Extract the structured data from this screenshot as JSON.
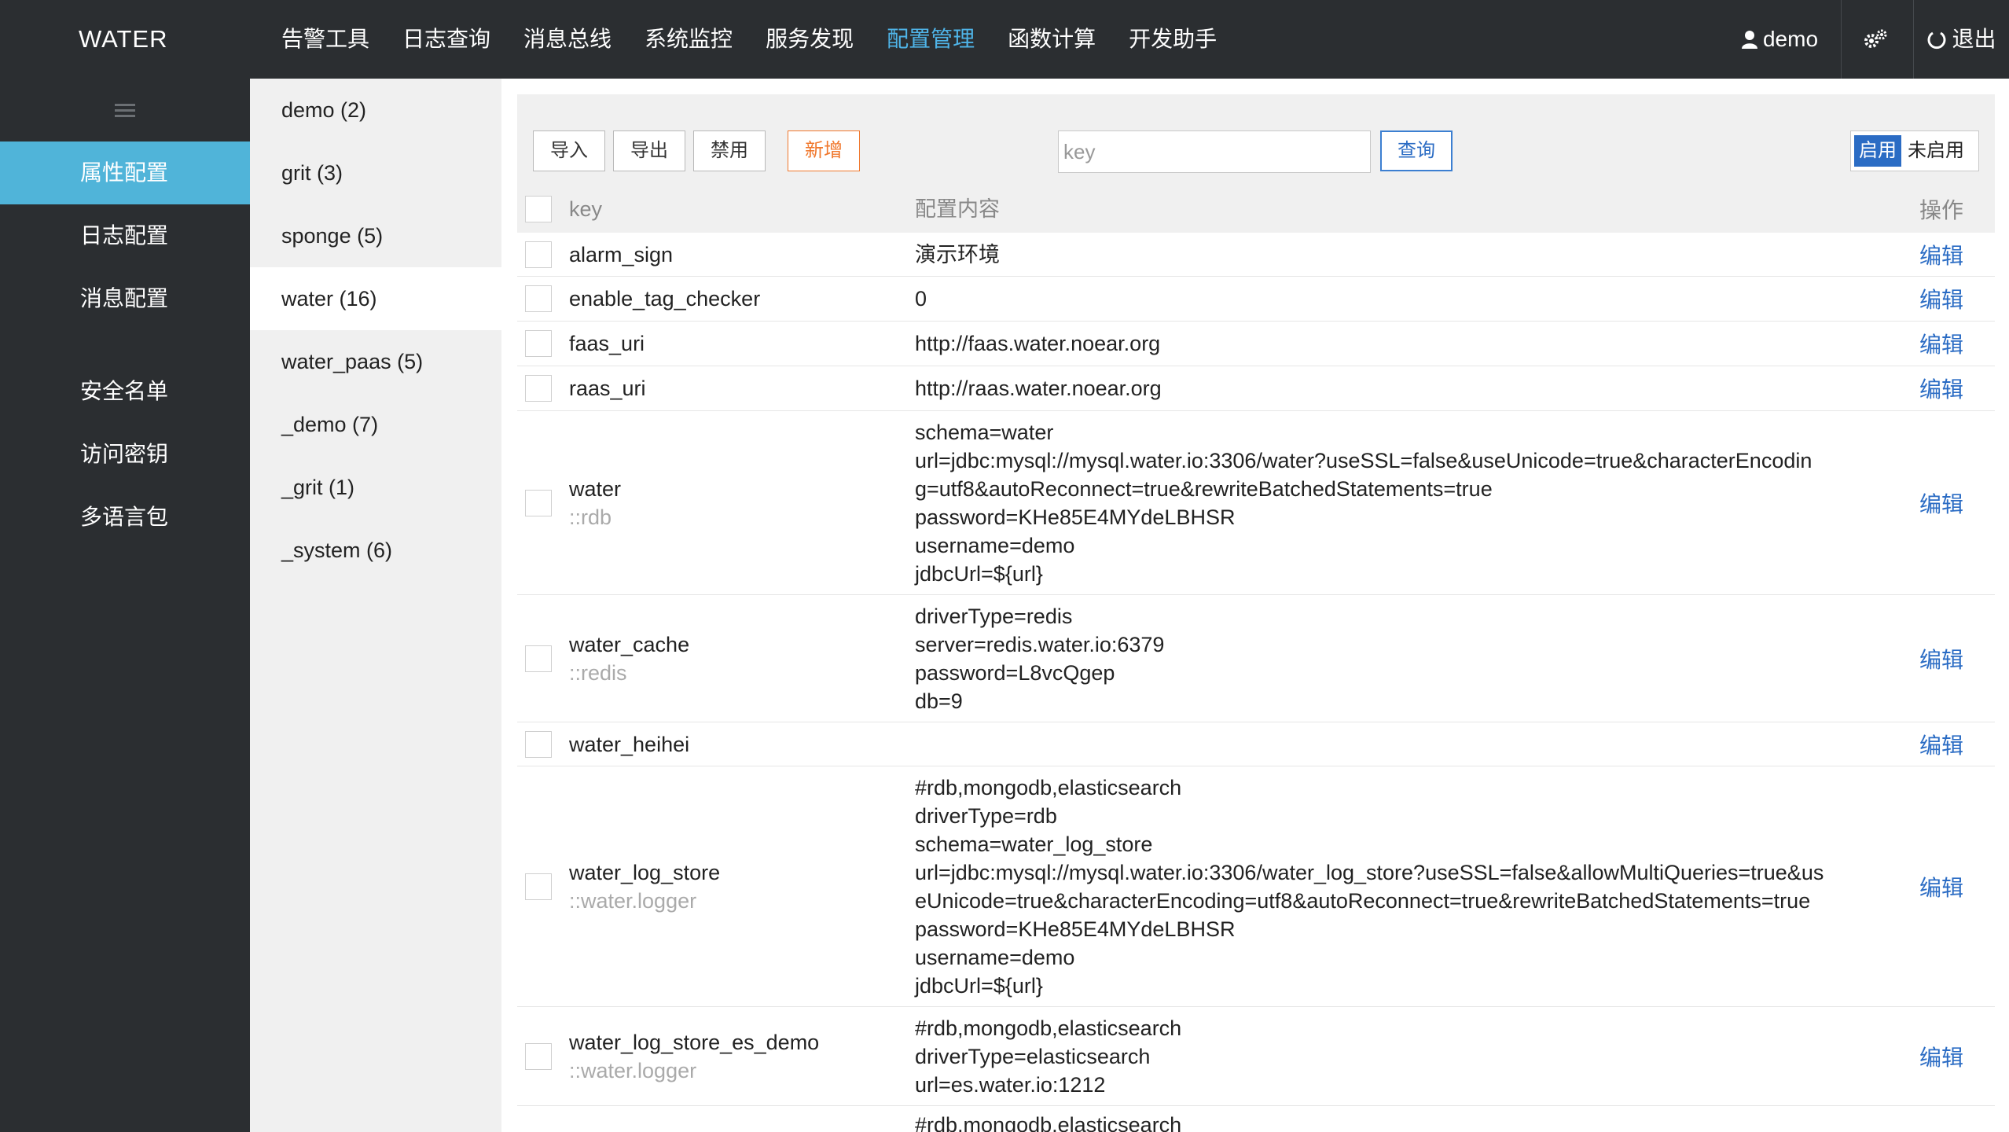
{
  "app": {
    "logo": "WATER"
  },
  "topnav": [
    {
      "label": "告警工具",
      "active": false
    },
    {
      "label": "日志查询",
      "active": false
    },
    {
      "label": "消息总线",
      "active": false
    },
    {
      "label": "系统监控",
      "active": false
    },
    {
      "label": "服务发现",
      "active": false
    },
    {
      "label": "配置管理",
      "active": true
    },
    {
      "label": "函数计算",
      "active": false
    },
    {
      "label": "开发助手",
      "active": false
    }
  ],
  "topright": {
    "user": "demo",
    "logout": "退出"
  },
  "sidebar": {
    "items": [
      {
        "label": "属性配置",
        "active": true
      },
      {
        "label": "日志配置",
        "active": false
      },
      {
        "label": "消息配置",
        "active": false
      },
      {
        "label": "安全名单",
        "active": false
      },
      {
        "label": "访问密钥",
        "active": false
      },
      {
        "label": "多语言包",
        "active": false
      }
    ]
  },
  "groups": [
    {
      "label": "demo (2)",
      "active": false
    },
    {
      "label": "grit (3)",
      "active": false
    },
    {
      "label": "sponge (5)",
      "active": false
    },
    {
      "label": "water (16)",
      "active": true
    },
    {
      "label": "water_paas (5)",
      "active": false
    },
    {
      "label": "_demo (7)",
      "active": false
    },
    {
      "label": "_grit (1)",
      "active": false
    },
    {
      "label": "_system (6)",
      "active": false
    }
  ],
  "toolbar": {
    "import": "导入",
    "export": "导出",
    "disable": "禁用",
    "add": "新增",
    "search_placeholder": "key",
    "query": "查询",
    "enabled": "启用",
    "disabled": "未启用"
  },
  "table": {
    "headers": {
      "key": "key",
      "value": "配置内容",
      "op": "操作"
    },
    "rows": [
      {
        "key": "alarm_sign",
        "sub": "",
        "value": "演示环境",
        "op": "编辑"
      },
      {
        "key": "enable_tag_checker",
        "sub": "",
        "value": "0",
        "op": "编辑"
      },
      {
        "key": "faas_uri",
        "sub": "",
        "value": "http://faas.water.noear.org",
        "op": "编辑"
      },
      {
        "key": "raas_uri",
        "sub": "",
        "value": "http://raas.water.noear.org",
        "op": "编辑"
      },
      {
        "key": "water",
        "sub": "::rdb",
        "value": "schema=water\nurl=jdbc:mysql://mysql.water.io:3306/water?useSSL=false&useUnicode=true&characterEncodin\ng=utf8&autoReconnect=true&rewriteBatchedStatements=true\npassword=KHe85E4MYdeLBHSR\nusername=demo\njdbcUrl=${url}",
        "op": "编辑"
      },
      {
        "key": "water_cache",
        "sub": "::redis",
        "value": "driverType=redis\nserver=redis.water.io:6379\npassword=L8vcQgep\ndb=9",
        "op": "编辑"
      },
      {
        "key": "water_heihei",
        "sub": "",
        "value": "",
        "op": "编辑"
      },
      {
        "key": "water_log_store",
        "sub": "::water.logger",
        "value": "#rdb,mongodb,elasticsearch\ndriverType=rdb\nschema=water_log_store\nurl=jdbc:mysql://mysql.water.io:3306/water_log_store?useSSL=false&allowMultiQueries=true&us\neUnicode=true&characterEncoding=utf8&autoReconnect=true&rewriteBatchedStatements=true\npassword=KHe85E4MYdeLBHSR\nusername=demo\njdbcUrl=${url}",
        "op": "编辑"
      },
      {
        "key": "water_log_store_es_demo",
        "sub": "::water.logger",
        "value": "#rdb,mongodb,elasticsearch\ndriverType=elasticsearch\nurl=es.water.io:1212",
        "op": "编辑"
      },
      {
        "key": "",
        "sub": "",
        "value": "#rdb,mongodb,elasticsearch",
        "op": ""
      }
    ]
  },
  "icons": {
    "user": "user-icon",
    "gear": "gears-icon",
    "power": "power-icon",
    "menu": "hamburger-icon"
  },
  "colors": {
    "accent": "#4fb4e8",
    "sidebar_active": "#50b4d9",
    "link": "#2b6cc4",
    "add": "#f0782d",
    "dark": "#2b2e31"
  }
}
